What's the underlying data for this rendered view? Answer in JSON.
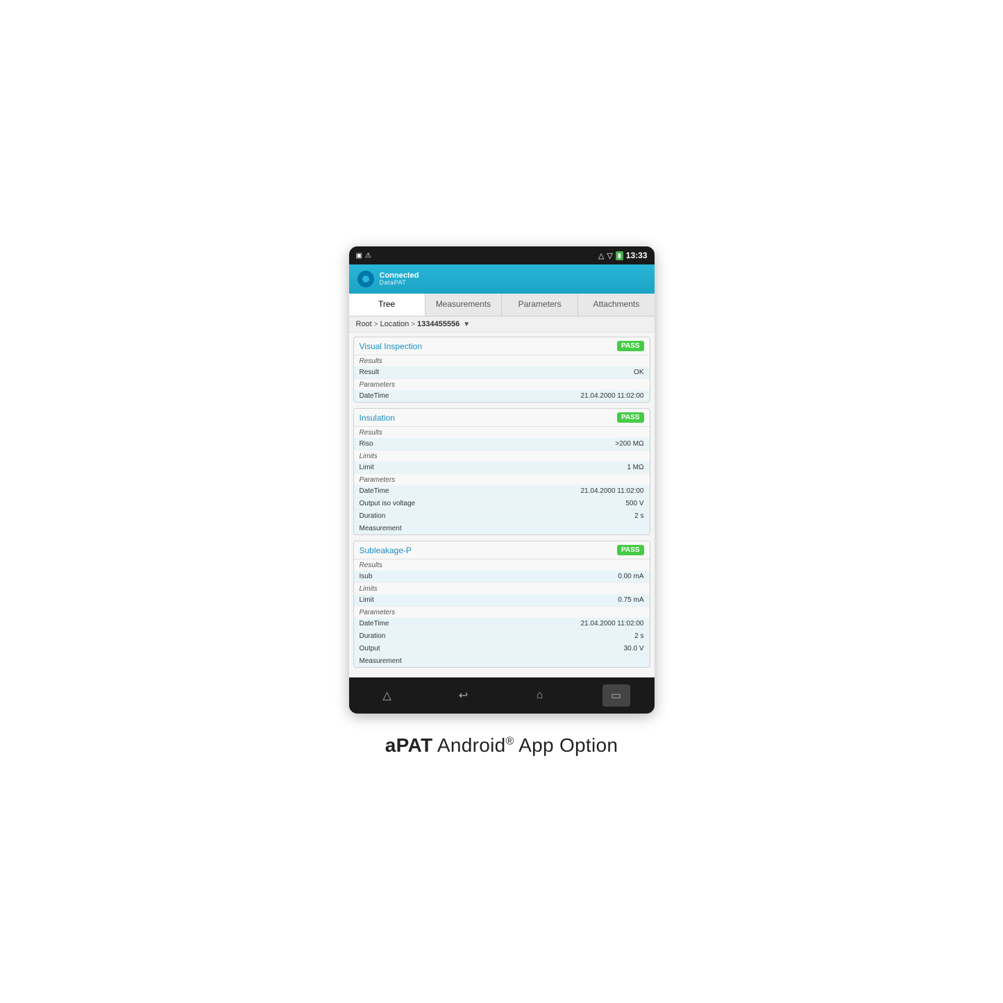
{
  "statusBar": {
    "leftIcons": [
      "▲",
      "⚠"
    ],
    "rightIcons": [
      "bluetooth",
      "wifi",
      "battery"
    ],
    "time": "13:33"
  },
  "appHeader": {
    "connected": "Connected",
    "datapat": "DataPAT"
  },
  "tabs": [
    {
      "label": "Tree",
      "active": true
    },
    {
      "label": "Measurements",
      "active": false
    },
    {
      "label": "Parameters",
      "active": false
    },
    {
      "label": "Attachments",
      "active": false
    }
  ],
  "breadcrumb": {
    "root": "Root",
    "location": "Location",
    "item": "1334455556"
  },
  "sections": [
    {
      "title": "Visual Inspection",
      "badge": "PASS",
      "groups": [
        {
          "label": "Results",
          "rows": [
            {
              "key": "Result",
              "value": "OK",
              "highlight": true
            }
          ]
        },
        {
          "label": "Parameters",
          "rows": [
            {
              "key": "DateTime",
              "value": "21.04.2000 11:02:00",
              "highlight": true
            }
          ]
        }
      ]
    },
    {
      "title": "Insulation",
      "badge": "PASS",
      "groups": [
        {
          "label": "Results",
          "rows": [
            {
              "key": "Riso",
              "value": ">200 MΩ",
              "highlight": true
            }
          ]
        },
        {
          "label": "Limits",
          "rows": [
            {
              "key": "Limit",
              "value": "1 MΩ",
              "highlight": true
            }
          ]
        },
        {
          "label": "Parameters",
          "rows": [
            {
              "key": "DateTime",
              "value": "21.04.2000 11:02:00",
              "highlight": true
            },
            {
              "key": "Output iso voltage",
              "value": "500 V",
              "highlight": true
            },
            {
              "key": "Duration",
              "value": "2 s",
              "highlight": true
            },
            {
              "key": "Measurement",
              "value": "",
              "highlight": true
            }
          ]
        }
      ]
    },
    {
      "title": "Subleakage-P",
      "badge": "PASS",
      "groups": [
        {
          "label": "Results",
          "rows": [
            {
              "key": "Isub",
              "value": "0.00 mA",
              "highlight": true
            }
          ]
        },
        {
          "label": "Limits",
          "rows": [
            {
              "key": "Limit",
              "value": "0.75 mA",
              "highlight": true
            }
          ]
        },
        {
          "label": "Parameters",
          "rows": [
            {
              "key": "DateTime",
              "value": "21.04.2000 11:02:00",
              "highlight": true
            },
            {
              "key": "Duration",
              "value": "2 s",
              "highlight": true
            },
            {
              "key": "Output",
              "value": "30.0 V",
              "highlight": true
            },
            {
              "key": "Measurement",
              "value": "",
              "highlight": true
            }
          ]
        }
      ]
    }
  ],
  "bottomNav": [
    {
      "icon": "⌂",
      "label": "home",
      "active": false
    },
    {
      "icon": "↩",
      "label": "back",
      "active": false
    },
    {
      "icon": "△",
      "label": "up",
      "active": false
    },
    {
      "icon": "▭",
      "label": "recent",
      "active": true
    }
  ],
  "caption": {
    "bold": "aPAT",
    "regular": " Android",
    "reg_symbol": "®",
    "rest": " App Option"
  }
}
